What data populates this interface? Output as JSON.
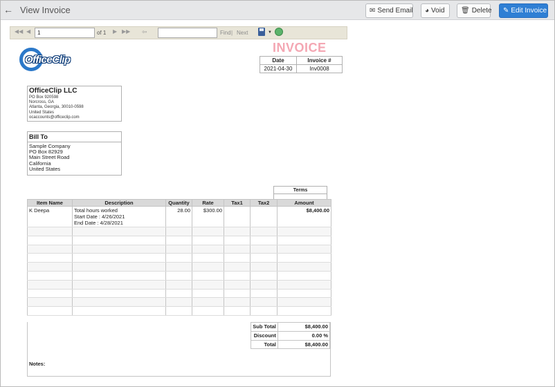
{
  "header": {
    "title": "View Invoice",
    "buttons": {
      "send_email": "Send Email",
      "void": "Void",
      "delete": "Delete",
      "edit_invoice": "Edit Invoice"
    }
  },
  "report_toolbar": {
    "page_value": "1",
    "of_text": "of 1",
    "find_label": "Find",
    "separator": "|",
    "next_label": "Next",
    "find_value": ""
  },
  "logo": {
    "text": "OfficeClip"
  },
  "invoice": {
    "title": "INVOICE",
    "date_header": "Date",
    "number_header": "Invoice #",
    "date": "2021-04-30",
    "number": "Inv0008"
  },
  "company": {
    "name": "OfficeClip LLC",
    "lines": [
      "PO Box 920598",
      "Norcross, GA",
      "Atlanta, Georgia, 30010-0598",
      "United States",
      "ocaccounts@officeclip.com"
    ]
  },
  "bill_to": {
    "heading": "Bill To",
    "lines": [
      "Sample Company",
      "PO Box 82929",
      "Main Street Road",
      "California",
      "United States"
    ]
  },
  "terms": {
    "label": "Terms"
  },
  "items": {
    "columns": [
      "Item Name",
      "Description",
      "Quantity",
      "Rate",
      "Tax1",
      "Tax2",
      "Amount"
    ],
    "rows": [
      {
        "item_name": "K Deepa",
        "description": [
          "Total hours worked",
          "Start Date : 4/26/2021",
          "End Date : 4/28/2021"
        ],
        "quantity": "28.00",
        "rate": "$300.00",
        "tax1": "",
        "tax2": "",
        "amount": "$8,400.00"
      }
    ]
  },
  "totals": {
    "subtotal_label": "Sub Total",
    "subtotal": "$8,400.00",
    "discount_label": "Discount",
    "discount": "0.00 %",
    "total_label": "Total",
    "total": "$8,400.00"
  },
  "notes": {
    "label": "Notes:"
  },
  "colors": {
    "accent": "#2f7fd4",
    "invoice_title": "#f4a7b3",
    "header_bg": "#e6e7e9"
  }
}
